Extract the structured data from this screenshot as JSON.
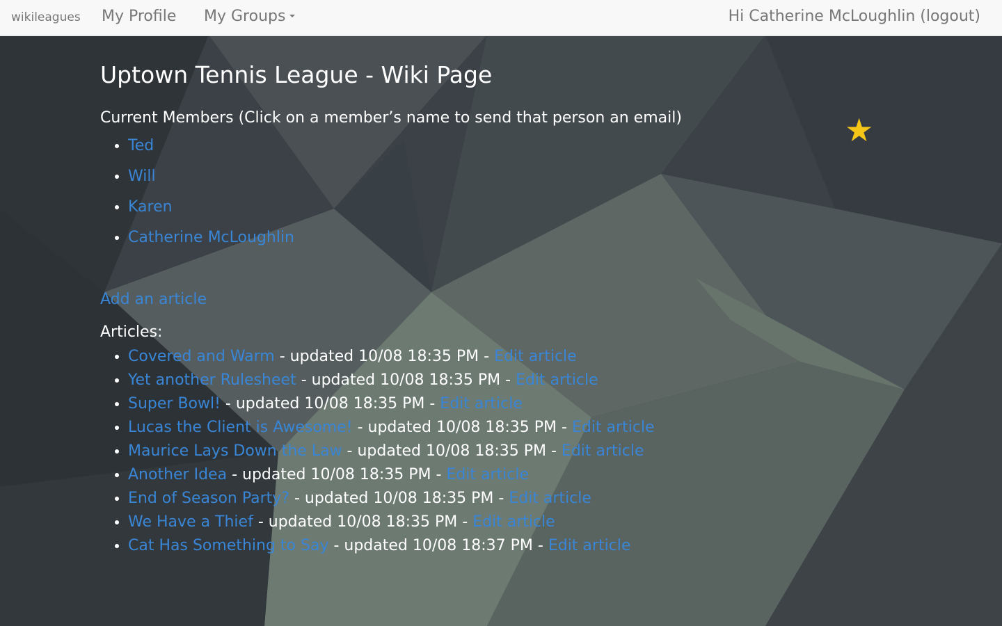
{
  "nav": {
    "brand": "wikileagues",
    "my_profile": "My Profile",
    "my_groups": "My Groups",
    "greeting": "Hi Catherine McLoughlin (logout)"
  },
  "page": {
    "title": "Uptown Tennis League - Wiki Page",
    "members_heading": "Current Members (Click on a member’s name to send that person an email)",
    "members": [
      "Ted",
      "Will",
      "Karen",
      "Catherine McLoughlin"
    ],
    "add_article": "Add an article",
    "articles_heading": "Articles:",
    "articles": [
      {
        "title": "Covered and Warm",
        "updated": " - updated 10/08 18:35 PM - ",
        "edit": "Edit article"
      },
      {
        "title": "Yet another Rulesheet",
        "updated": " - updated 10/08 18:35 PM - ",
        "edit": "Edit article"
      },
      {
        "title": "Super Bowl!",
        "updated": " - updated 10/08 18:35 PM - ",
        "edit": "Edit article"
      },
      {
        "title": "Lucas the Client is Awesome!",
        "updated": " - updated 10/08 18:35 PM - ",
        "edit": "Edit article"
      },
      {
        "title": "Maurice Lays Down the Law",
        "updated": " - updated 10/08 18:35 PM - ",
        "edit": "Edit article"
      },
      {
        "title": "Another Idea",
        "updated": " - updated 10/08 18:35 PM - ",
        "edit": "Edit article"
      },
      {
        "title": "End of Season Party?",
        "updated": " - updated 10/08 18:35 PM - ",
        "edit": "Edit article"
      },
      {
        "title": "We Have a Thief",
        "updated": " - updated 10/08 18:35 PM - ",
        "edit": "Edit article"
      },
      {
        "title": "Cat Has Something to Say",
        "updated": " - updated 10/08 18:37 PM - ",
        "edit": "Edit article"
      }
    ]
  },
  "colors": {
    "link": "#3a86d6",
    "star": "#f5c518",
    "navbar_bg": "#f8f8f8"
  },
  "icons": {
    "favorite": "star-icon",
    "dropdown": "caret-down-icon"
  }
}
